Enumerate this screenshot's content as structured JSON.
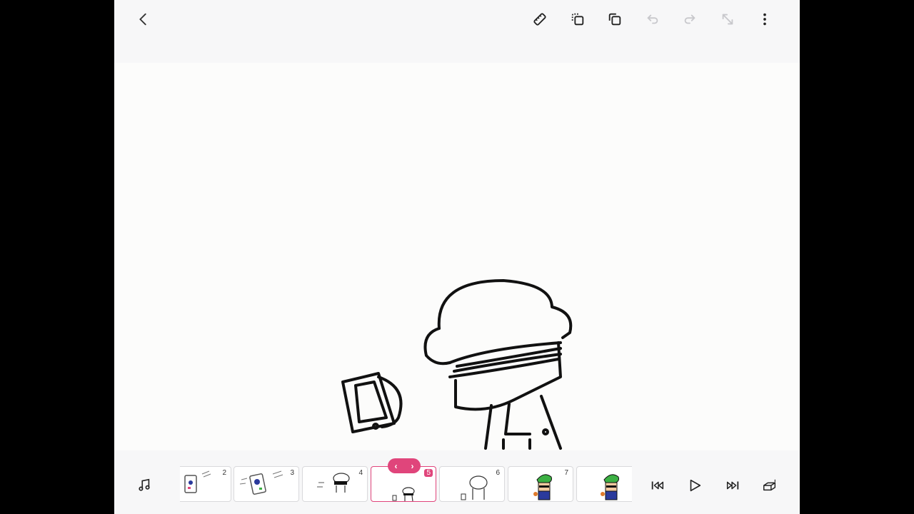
{
  "toolbar": {
    "icons": [
      "back-icon",
      "ruler-icon",
      "duplicate-frame-icon",
      "copy-icon",
      "undo-icon",
      "redo-icon",
      "resize-icon",
      "more-icon"
    ]
  },
  "timeline": {
    "frames": [
      {
        "number": "2"
      },
      {
        "number": "3"
      },
      {
        "number": "4"
      },
      {
        "number": "5",
        "selected": true
      },
      {
        "number": "6"
      },
      {
        "number": "7"
      },
      {
        "number": ""
      }
    ],
    "nav_prev": "‹",
    "nav_next": "›"
  },
  "colors": {
    "accent": "#e0457b",
    "character_green": "#3cb043",
    "character_blue": "#2b3a9c",
    "ink": "#111111"
  }
}
